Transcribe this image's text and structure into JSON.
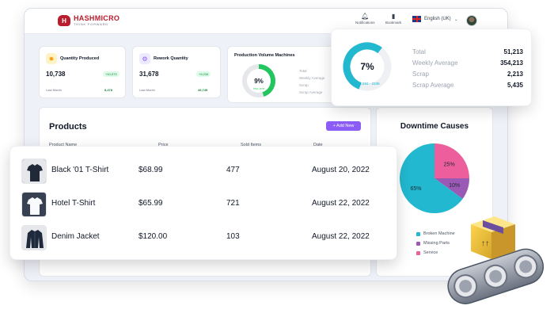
{
  "brand": {
    "name": "HASHMICRO",
    "tagline": "THINK FORWARD"
  },
  "topbar": {
    "notifications_label": "Notifications",
    "bookmark_label": "Bookmark",
    "language": "English (UK)"
  },
  "stats": [
    {
      "title": "Quantity Produced",
      "value": "10,738",
      "badge": "+10,073",
      "sub_label": "Last Month",
      "sub_value": "8,478"
    },
    {
      "title": "Rework Quantity",
      "value": "31,678",
      "badge": "+9,234",
      "sub_label": "Last Month",
      "sub_value": "49,745"
    }
  ],
  "production_volume": {
    "title": "Production Volume Machines",
    "percent": "9%",
    "percent_value": 0.09,
    "sub": "PNG.1678",
    "legend": [
      "Total",
      "Weekly Average",
      "Scrap",
      "Scrap Average"
    ]
  },
  "summary": {
    "percent": "7%",
    "percent_value": 0.07,
    "sub": "1,934 - 2346",
    "rows": [
      {
        "label": "Total",
        "value": "51,213"
      },
      {
        "label": "Weekly Average",
        "value": "354,213"
      },
      {
        "label": "Scrap",
        "value": "2,213"
      },
      {
        "label": "Scrap Average",
        "value": "5,435"
      }
    ]
  },
  "products": {
    "title": "Products",
    "add_label": "+ Add New",
    "columns": [
      "Product Name",
      "Price",
      "Sold Items",
      "Date"
    ],
    "rows": [
      {
        "name": "Black '01 T-Shirt",
        "price": "$68.99",
        "sold": "477",
        "date": "August 20, 2022",
        "thumb": "black-shirt"
      },
      {
        "name": "Hotel T-Shirt",
        "price": "$65.99",
        "sold": "721",
        "date": "August 22, 2022",
        "thumb": "white-shirt"
      },
      {
        "name": "Denim Jacket",
        "price": "$120.00",
        "sold": "103",
        "date": "August 22, 2022",
        "thumb": "denim-jacket"
      }
    ]
  },
  "downtime": {
    "title": "Downtime Causes",
    "chart_data": {
      "type": "pie",
      "title": "Downtime Causes",
      "categories": [
        "Broken Machine",
        "Missing Parts",
        "Service"
      ],
      "values": [
        65,
        10,
        25
      ],
      "labels": [
        "65%",
        "10%",
        "25%"
      ]
    },
    "colors": [
      "#22b8cf",
      "#9b59b6",
      "#ec5f9c"
    ]
  },
  "colors": {
    "accent": "#8b5cf6",
    "brand": "#b91c2c",
    "gauge": "#22b8cf",
    "gauge_green": "#22c55e"
  }
}
